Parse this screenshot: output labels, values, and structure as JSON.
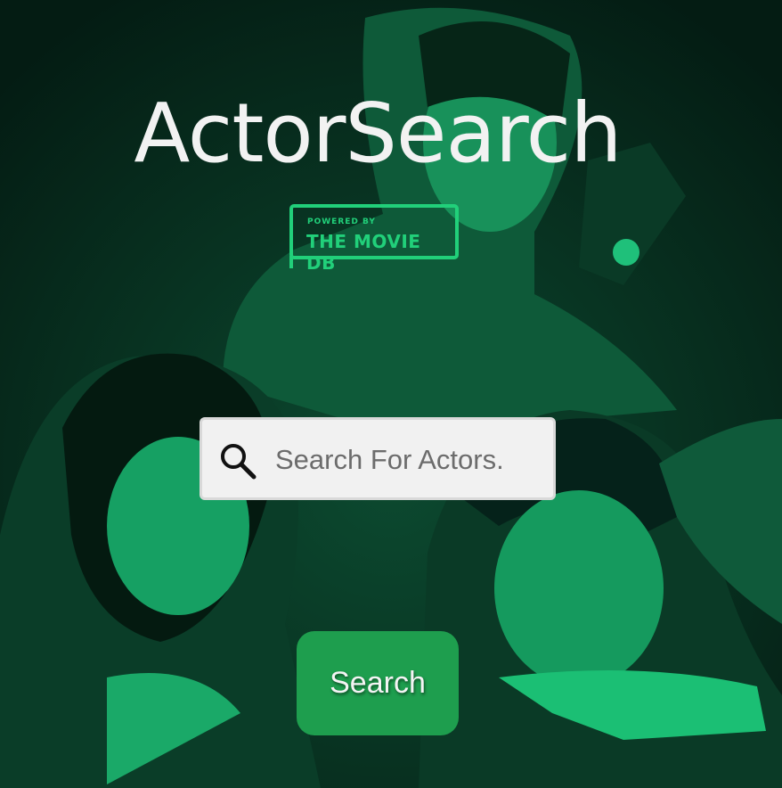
{
  "app": {
    "title": "ActorSearch"
  },
  "badge": {
    "line1": "POWERED BY",
    "line2": "THE MOVIE DB"
  },
  "search": {
    "placeholder": "Search For Actors.",
    "value": ""
  },
  "button": {
    "label": "Search"
  },
  "icons": {
    "search": "magnifier-icon"
  },
  "colors": {
    "accent": "#21d07a",
    "button": "#1e9e4e",
    "background": "#06281c",
    "input_bg": "#f1f1f1"
  }
}
